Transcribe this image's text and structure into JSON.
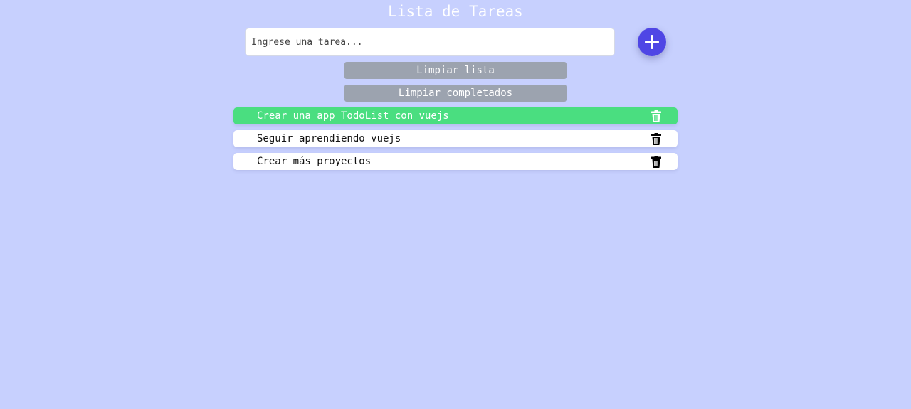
{
  "header": {
    "title": "Lista de Tareas"
  },
  "input": {
    "placeholder": "Ingrese una tarea...",
    "value": ""
  },
  "add_button": {
    "icon": "plus-icon"
  },
  "actions": {
    "clear_all_label": "Limpiar lista",
    "clear_completed_label": "Limpiar completados"
  },
  "tasks": [
    {
      "text": "Crear una app TodoList con vuejs",
      "completed": true
    },
    {
      "text": "Seguir aprendiendo vuejs",
      "completed": false
    },
    {
      "text": "Crear más proyectos",
      "completed": false
    }
  ],
  "colors": {
    "background": "#c7d0fe",
    "accent": "#4f46e5",
    "completed": "#4ade80",
    "button_gray": "#9ca3af"
  }
}
